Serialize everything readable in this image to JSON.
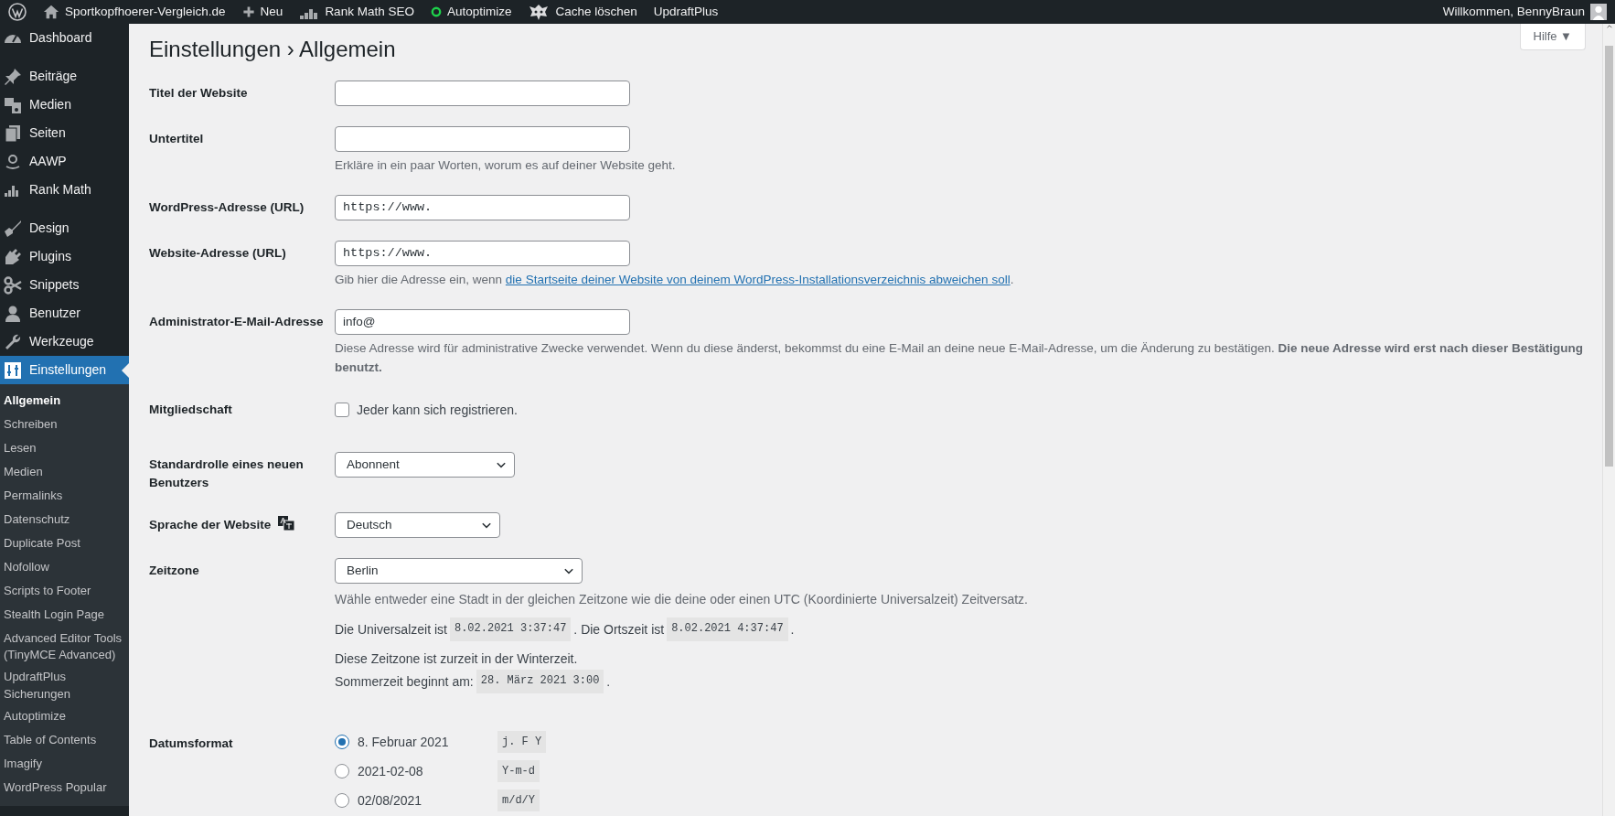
{
  "admin_bar": {
    "items": [
      {
        "kind": "logo"
      },
      {
        "kind": "home",
        "label": "Sportkopfhoerer-Vergleich.de"
      },
      {
        "kind": "plus",
        "label": "Neu"
      },
      {
        "kind": "bars",
        "label": "Rank Math SEO"
      },
      {
        "kind": "ring",
        "label": "Autoptimize"
      },
      {
        "kind": "burst",
        "label": "Cache löschen"
      },
      {
        "kind": "plain",
        "label": "UpdraftPlus"
      }
    ],
    "greeting": "Willkommen, BennyBraun"
  },
  "sidebar": {
    "groups": [
      {
        "items": [
          {
            "label": "Dashboard",
            "selected": false
          }
        ]
      },
      {
        "items": [
          {
            "label": "Beiträge",
            "selected": false
          },
          {
            "label": "Medien",
            "selected": false
          },
          {
            "label": "Seiten",
            "selected": false
          },
          {
            "label": "AAWP",
            "selected": false
          },
          {
            "label": "Rank Math",
            "selected": false
          }
        ]
      },
      {
        "items": [
          {
            "label": "Design",
            "selected": false
          },
          {
            "label": "Plugins",
            "selected": false
          },
          {
            "label": "Snippets",
            "selected": false
          },
          {
            "label": "Benutzer",
            "selected": false
          },
          {
            "label": "Werkzeuge",
            "selected": false
          },
          {
            "label": "Einstellungen",
            "selected": true,
            "children": [
              {
                "label": "Allgemein",
                "selected": true
              },
              {
                "label": "Schreiben",
                "selected": false
              },
              {
                "label": "Lesen",
                "selected": false
              },
              {
                "label": "Medien",
                "selected": false
              },
              {
                "label": "Permalinks",
                "selected": false
              },
              {
                "label": "Datenschutz",
                "selected": false
              },
              {
                "label": "Duplicate Post",
                "selected": false
              },
              {
                "label": "Nofollow",
                "selected": false
              },
              {
                "label": "Scripts to Footer",
                "selected": false
              },
              {
                "label": "Stealth Login Page",
                "selected": false
              },
              {
                "label": "Advanced Editor Tools (TinyMCE Advanced)",
                "selected": false
              },
              {
                "label": "UpdraftPlus Sicherungen",
                "selected": false
              },
              {
                "label": "Autoptimize",
                "selected": false
              },
              {
                "label": "Table of Contents",
                "selected": false
              },
              {
                "label": "Imagify",
                "selected": false
              },
              {
                "label": "WordPress Popular",
                "selected": false
              }
            ]
          }
        ]
      }
    ]
  },
  "page": {
    "title": "Einstellungen › Allgemein",
    "help_button": "Hilfe ▼"
  },
  "settings": [
    {
      "kind": "text",
      "label": "Titel der Website"
    },
    {
      "kind": "text",
      "label": "Untertitel",
      "description": "Erkläre in ein paar Worten, worum es auf deiner Website geht."
    },
    {
      "kind": "url",
      "label": "WordPress-Adresse (URL)",
      "value": "https://www."
    },
    {
      "kind": "url",
      "label": "Website-Adresse (URL)",
      "value": "https://www.",
      "description": "Gib hier die Adresse ein, wenn",
      "link": "die Startseite deiner Website von deinem WordPress-Installationsverzeichnis abweichen soll",
      "description_end": "."
    },
    {
      "kind": "text",
      "label": "Administrator-E-Mail-Adresse",
      "value": "info@",
      "description": "Diese Adresse wird für administrative Zwecke verwendet. Wenn du diese änderst, bekommst du eine E-Mail an deine neue E-Mail-Adresse, um die Änderung zu bestätigen. **Die neue Adresse wird erst nach dieser Bestätigung benutzt.**"
    },
    {
      "kind": "checkbox",
      "label": "Mitgliedschaft",
      "option": "Jeder kann sich registrieren.",
      "checked": false
    },
    {
      "kind": "select",
      "label": "Standardrolle eines neuen Benutzers",
      "value": "Abonnent"
    },
    {
      "kind": "language",
      "label": "Sprache der Website",
      "value": "Deutsch"
    },
    {
      "kind": "select",
      "label": "Zeitzone",
      "value": "Berlin",
      "notes": [
        [
          [
            {
              "kind": "text",
              "text": "Wähle entweder eine Stadt in der gleichen Zeitzone wie die deine oder einen UTC (Koordinierte Universalzeit) Zeitversatz."
            }
          ]
        ],
        [
          [
            {
              "kind": "text",
              "text": "Die Universalzeit ist"
            },
            {
              "kind": "code",
              "text": "8.02.2021 3:37:47"
            },
            {
              "kind": "text",
              "text": ". Die Ortszeit ist"
            },
            {
              "kind": "code",
              "text": "8.02.2021 4:37:47"
            },
            {
              "kind": "text",
              "text": "."
            }
          ]
        ],
        [
          [
            {
              "kind": "text",
              "text": "Diese Zeitzone ist zurzeit in der Winterzeit."
            }
          ],
          [
            {
              "kind": "text",
              "text": "Sommerzeit beginnt am:"
            },
            {
              "kind": "code",
              "text": "28. März 2021 3:00"
            },
            {
              "kind": "text",
              "text": "."
            }
          ]
        ]
      ]
    },
    {
      "kind": "radio",
      "label": "Datumsformat",
      "options": [
        {
          "label": "8. Februar 2021",
          "code": "j. F Y",
          "selected": true
        },
        {
          "label": "2021-02-08",
          "code": "Y-m-d",
          "selected": false
        },
        {
          "label": "02/08/2021",
          "code": "m/d/Y",
          "selected": false
        }
      ]
    }
  ]
}
